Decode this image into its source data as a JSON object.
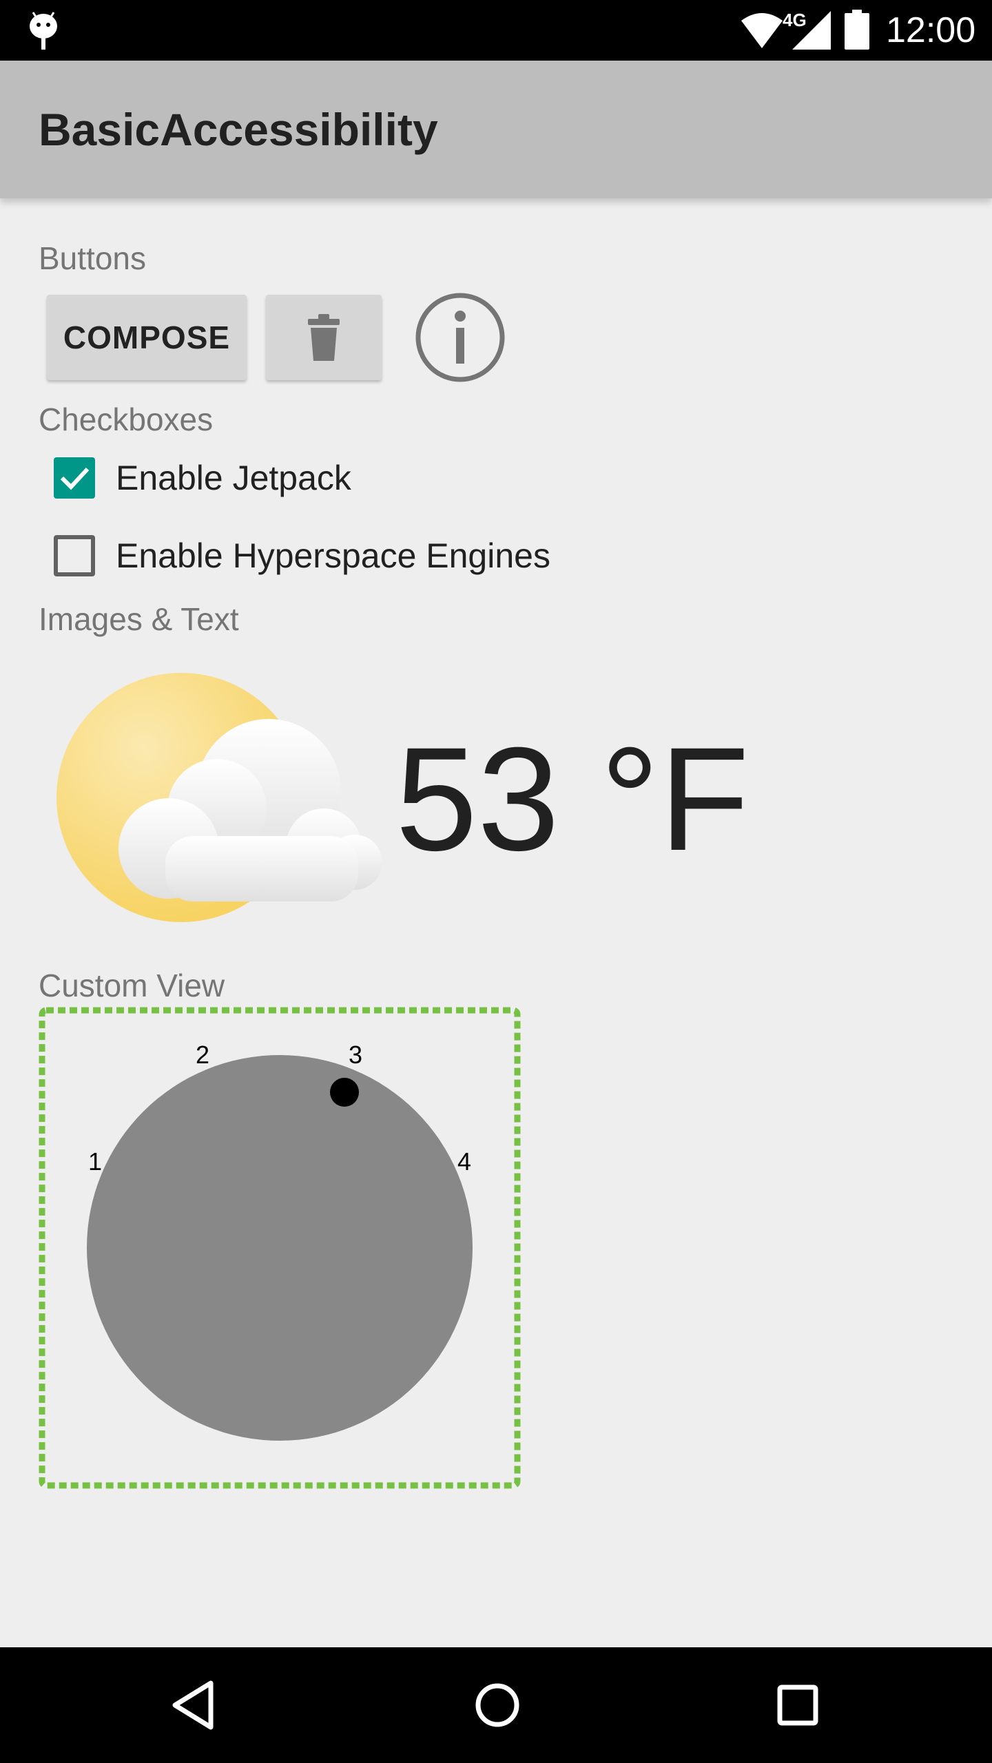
{
  "status_bar": {
    "network_label": "4G",
    "time": "12:00"
  },
  "app_bar": {
    "title": "BasicAccessibility"
  },
  "sections": {
    "buttons": "Buttons",
    "checkboxes": "Checkboxes",
    "images_text": "Images & Text",
    "custom_view": "Custom View"
  },
  "buttons": {
    "compose_label": "COMPOSE",
    "delete_icon": "trash-icon",
    "info_icon": "info-icon"
  },
  "checkboxes": [
    {
      "label": "Enable Jetpack",
      "checked": true
    },
    {
      "label": "Enable Hyperspace Engines",
      "checked": false
    }
  ],
  "weather": {
    "icon": "partly-cloudy-icon",
    "temperature": "53 °F"
  },
  "dial": {
    "labels": [
      "1",
      "2",
      "3",
      "4"
    ],
    "selected": "3",
    "knob_color": "#888888",
    "border_color": "#76c043"
  },
  "colors": {
    "accent": "#009688",
    "app_bar": "#bdbdbd",
    "background": "#eeeeee"
  }
}
